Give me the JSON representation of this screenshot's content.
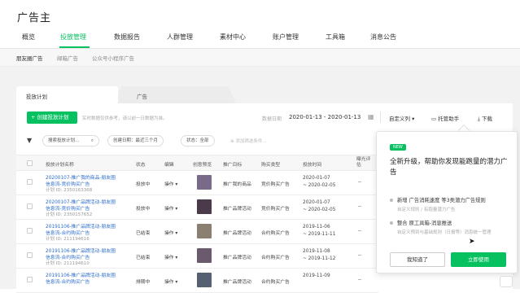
{
  "app": {
    "title": "广告主"
  },
  "nav": {
    "items": [
      "概览",
      "投放管理",
      "数据报告",
      "人群管理",
      "素材中心",
      "账户管理",
      "工具箱",
      "消息公告"
    ]
  },
  "subnav": {
    "items": [
      "朋友圈广告",
      "邮箱广告",
      "公众号小程序广告"
    ]
  },
  "tabs": [
    "投放计划",
    "广告"
  ],
  "toolbar": {
    "create": "+ 创建投放计划",
    "hint": "实时数据仅供参考，请以前一日数据为准。",
    "date_label": "数据日期",
    "date_range": "2020-01-13 - 2020-01-13",
    "columns": "自定义列 ▾",
    "hosting": "托管助手",
    "download": "下载"
  },
  "filters": {
    "search_placeholder": "搜索投放计划...",
    "created": "创建日期：最近三个月",
    "status": "状态：全部",
    "add": "添加筛选条件..."
  },
  "table": {
    "headers": [
      "投放计划名称",
      "状态",
      "编辑",
      "创意预览",
      "推广目标",
      "购买类型",
      "投放时间",
      "曝光评估"
    ],
    "rows": [
      {
        "name": "20200107-推广我的商品-朋友圈",
        "name2": "信息流-竞价购买广告",
        "id": "计划 ID: 2350163368",
        "status": "投放中",
        "edit": "操作 ▾",
        "goal": "推广我的商品",
        "buy": "竞价购买广告",
        "time1": "2020-01-07",
        "time2": "~ 2020-02-05",
        "exposure": "--",
        "thumb": "#7a6a8a"
      },
      {
        "name": "20200107-推广品牌活动-朋友圈",
        "name2": "信息流-竞价购买广告",
        "id": "计划 ID: 2350157652",
        "status": "投放中",
        "edit": "操作 ▾",
        "goal": "推广品牌活动",
        "buy": "竞价购买广告",
        "time1": "2020-01-07",
        "time2": "~ 2020-02-05",
        "exposure": "--",
        "thumb": "#4a3a4a"
      },
      {
        "name": "20191106-推广品牌活动-朋友圈",
        "name2": "信息流-合约购买广告",
        "id": "计划 ID: 211194616",
        "status": "已结束",
        "edit": "操作 ▾",
        "goal": "推广品牌活动",
        "buy": "合约购买广告",
        "time1": "2019-11-06",
        "time2": "~ 2019-11-11",
        "exposure": "--",
        "thumb": "#8a7f70"
      },
      {
        "name": "20191106-推广品牌活动-朋友圈",
        "name2": "信息流-合约购买广告",
        "id": "计划 ID: 211194610",
        "status": "已结束",
        "edit": "操作 ▾",
        "goal": "推广品牌活动",
        "buy": "合约购买广告",
        "time1": "2019-11-08",
        "time2": "~ 2019-11-12",
        "exposure": "--",
        "thumb": "#6b5a6e"
      },
      {
        "name": "20191106-推广品牌活动-朋友圈",
        "name2": "信息流-合约购买广告",
        "id": "",
        "status": "排期中",
        "edit": "操作 ▾",
        "goal": "推广品牌活动",
        "buy": "合约购买广告",
        "time1": "2019-11-09",
        "time2": "",
        "exposure": "--",
        "thumb": "#556070"
      }
    ]
  },
  "popup": {
    "badge": "NEW",
    "title": "全新升级，帮助你发现能跑量的潜力广告",
    "f1": "新增 广告消耗速度 等3类潜力广告规则",
    "f1_sub": "自定义规则 / 有跑量潜力广告",
    "f2": "整合 原工具箱-消息推送",
    "f2_sub": "自定义预到与基础规则（日报等）消息统一管理",
    "ok": "我知道了",
    "use": "立即使用"
  },
  "colors": {
    "accent": "#07c160",
    "link": "#2a6bcc"
  }
}
